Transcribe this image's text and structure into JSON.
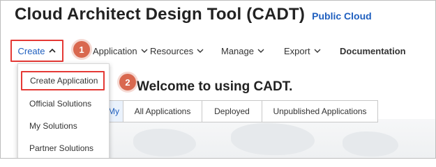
{
  "app": {
    "title": "Cloud Architect Design Tool (CADT)",
    "badge": "Public Cloud"
  },
  "nav": {
    "create": "Create",
    "application": "Application",
    "resources": "Resources",
    "manage": "Manage",
    "export": "Export",
    "documentation": "Documentation"
  },
  "steps": {
    "one": "1",
    "two": "2"
  },
  "welcome": "Welcome to using CADT.",
  "tabs": {
    "first": "My",
    "all": "All Applications",
    "deployed": "Deployed",
    "unpublished": "Unpublished Applications"
  },
  "create_menu": {
    "items": [
      "Create Application",
      "Official Solutions",
      "My Solutions",
      "Partner Solutions"
    ]
  },
  "colors": {
    "accent": "#1f5fbf",
    "highlight_border": "#e53935",
    "step_badge": "#d9684f"
  }
}
